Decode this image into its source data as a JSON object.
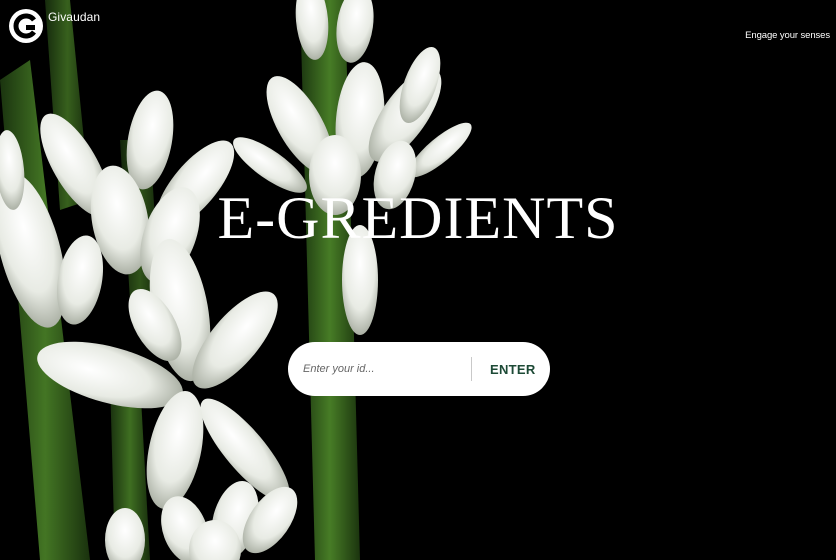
{
  "brand": {
    "name": "Givaudan",
    "tagline": "Engage your senses",
    "logo_icon": "givaudan-g-logo"
  },
  "hero": {
    "title": "E-GREDIENTS",
    "background": "white tuberose flowers on black"
  },
  "login": {
    "placeholder": "Enter your id...",
    "value": "",
    "submit_label": "ENTER"
  },
  "colors": {
    "background": "#000000",
    "text": "#ffffff",
    "button_text": "#1d4a36",
    "field_bg": "#ffffff"
  }
}
